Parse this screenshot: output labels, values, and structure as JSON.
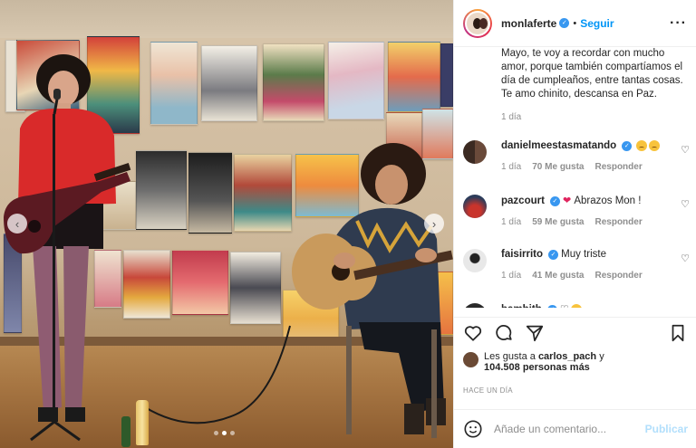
{
  "post": {
    "username": "monlaferte",
    "follow_label": "Seguir",
    "separator": "•",
    "more_label": "···",
    "caption": "Mayo, te voy a recordar con mucho amor, porque también compartíamos el día de cumpleaños, entre tantas cosas. Te amo chinito, descansa en Paz.",
    "caption_time": "1 día"
  },
  "comments": [
    {
      "username": "danielmeestasmatando",
      "verified": true,
      "text": "",
      "emojis": 2,
      "time": "1 día",
      "likes": "70 Me gusta",
      "reply": "Responder"
    },
    {
      "username": "pazcourt",
      "verified": true,
      "text": "Abrazos Mon !",
      "heart": true,
      "time": "1 día",
      "likes": "59 Me gusta",
      "reply": "Responder"
    },
    {
      "username": "faisirrito",
      "verified": true,
      "text": "Muy triste",
      "time": "1 día",
      "likes": "41 Me gusta",
      "reply": "Responder"
    },
    {
      "username": "bambith",
      "verified": true,
      "text": "",
      "time": "",
      "likes": "",
      "reply": ""
    }
  ],
  "likes": {
    "prefix": "Les gusta a",
    "user": "carlos_pach",
    "conj": "y",
    "count_text": "104.508 personas más"
  },
  "timestamp": "HACE UN DÍA",
  "add_comment": {
    "placeholder": "Añade un comentario...",
    "publish_label": "Publicar"
  },
  "icons": {
    "like": "heart-icon",
    "comment": "comment-icon",
    "share": "share-icon",
    "save": "bookmark-icon",
    "emoji": "emoji-icon"
  },
  "colors": {
    "link": "#0095f6",
    "publish_disabled": "#b2dffc",
    "verified": "#3897f0",
    "secondary_text": "#8e8e8e"
  },
  "carousel": {
    "current": 2,
    "total": 3
  }
}
